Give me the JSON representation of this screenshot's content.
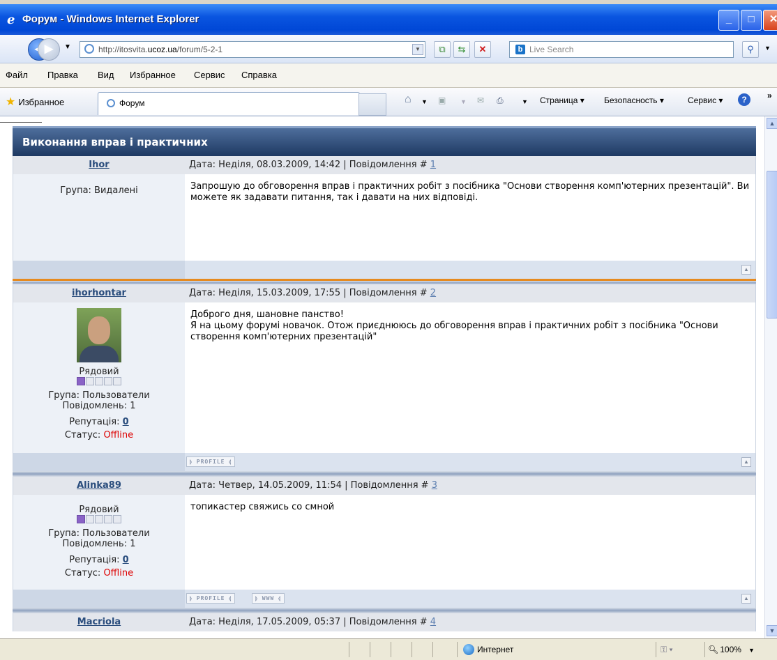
{
  "window": {
    "title": "Форум - Windows Internet Explorer"
  },
  "address": {
    "prefix": "http://itosvita.",
    "domain": "ucoz.ua",
    "path": "/forum/5-2-1"
  },
  "search": {
    "placeholder": "Live Search"
  },
  "menu": [
    "Файл",
    "Правка",
    "Вид",
    "Избранное",
    "Сервис",
    "Справка"
  ],
  "favorites": {
    "label": "Избранное",
    "tab_title": "Форум"
  },
  "commands": {
    "page": "Страница",
    "safety": "Безопасность",
    "tools": "Сервис"
  },
  "status": {
    "zone": "Интернет",
    "zoom": "100%"
  },
  "forum": {
    "title": "Виконання вправ і практичних",
    "posts": [
      {
        "user": "Ihor",
        "date": "Дата: Неділя, 08.03.2009, 14:42 | Повідомлення # ",
        "num": "1",
        "group": "Група: Видалені",
        "message": "Запрошую до обговорення вправ і практичних робіт з посібника \"Основи створення комп'ютерних презентацій\". Ви можете як задавати питання, так і давати на них відповіді."
      },
      {
        "user": "ihorhontar",
        "date": "Дата: Неділя, 15.03.2009, 17:55 | Повідомлення # ",
        "num": "2",
        "rank": "Рядовий",
        "stars_on": 1,
        "stars_total": 5,
        "group": "Група: Пользователи",
        "count": "Повідомлень: 1",
        "rep_label": "Репутація: ",
        "rep": "0",
        "status_label": "Статус: ",
        "status": "Offline",
        "line1": "Доброго дня, шановне панство!",
        "line2": "Я на цьому форумі новачок. Отож приєднююсь до обговорення вправ і практичних робіт з посібника \"Основи створення комп'ютерних презентацій\"",
        "btn_profile": "PROFILE"
      },
      {
        "user": "Alinka89",
        "date": "Дата: Четвер, 14.05.2009, 11:54 | Повідомлення # ",
        "num": "3",
        "rank": "Рядовий",
        "stars_on": 1,
        "stars_total": 5,
        "group": "Група: Пользователи",
        "count": "Повідомлень: 1",
        "rep_label": "Репутація: ",
        "rep": "0",
        "status_label": "Статус: ",
        "status": "Offline",
        "message": "топикастер свяжись со смной",
        "btn_profile": "PROFILE",
        "btn_www": "WWW"
      },
      {
        "user": "Macriola",
        "date": "Дата: Неділя, 17.05.2009, 05:37 | Повідомлення # ",
        "num": "4"
      }
    ]
  }
}
